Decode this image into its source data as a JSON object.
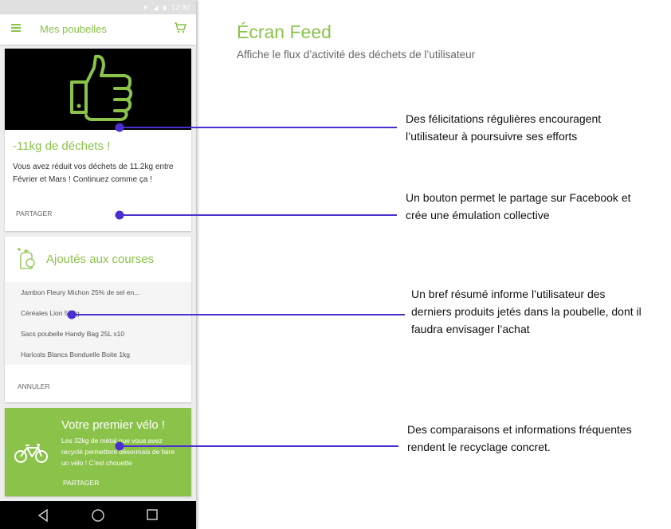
{
  "status_bar": {
    "time": "12:30",
    "icons": [
      "wifi-icon",
      "signal-icon",
      "battery-icon"
    ]
  },
  "app_bar": {
    "title": "Mes poubelles",
    "menu_icon": "hamburger-menu-icon",
    "cart_icon": "shopping-cart-icon"
  },
  "cards": {
    "congrats": {
      "image_icon": "thumbs-up-icon",
      "headline": "-11kg de déchets !",
      "body": "Vous avez réduit vos déchets de 11.2kg entre Février et Mars ! Continuez comme ça !",
      "action": "PARTAGER"
    },
    "shopping": {
      "icon": "shopping-bag-icon",
      "headline": "Ajoutés aux courses",
      "items": [
        "Jambon Fleury Michon 25% de sel en...",
        "Céréales Lion 500g",
        "Sacs poubelle Handy Bag 25L x10",
        "Haricots Blancs Bonduelle Boite 1kg"
      ],
      "action": "ANNULER"
    },
    "bike": {
      "icon": "bicycle-icon",
      "headline": "Votre premier vélo !",
      "body": "Les 32kg de métal que vous avez recyclé permettent désormais de faire un vélo ! C'est chouette",
      "action": "PARTAGER"
    }
  },
  "nav_bar": {
    "icons": [
      "back-triangle-icon",
      "home-circle-icon",
      "recent-square-icon"
    ]
  },
  "annotations": {
    "screen_title": "Écran Feed",
    "screen_subtitle": "Affiche le flux d’activité des déchets de l’utilisateur",
    "notes": [
      "Des félicitations régulières encouragent l’utilisateur à poursuivre ses efforts",
      "Un bouton permet le partage sur Facebook et crée une émulation collective",
      "Un bref résumé informe l’utilisateur des derniers produits jetés dans la poubelle, dont il faudra envisager l’achat",
      "Des comparaisons et informations fréquentes rendent le recyclage concret."
    ]
  },
  "colors": {
    "brand_green": "#8bc34a",
    "callout_purple": "#4b2fd1",
    "nav_black": "#000000"
  }
}
